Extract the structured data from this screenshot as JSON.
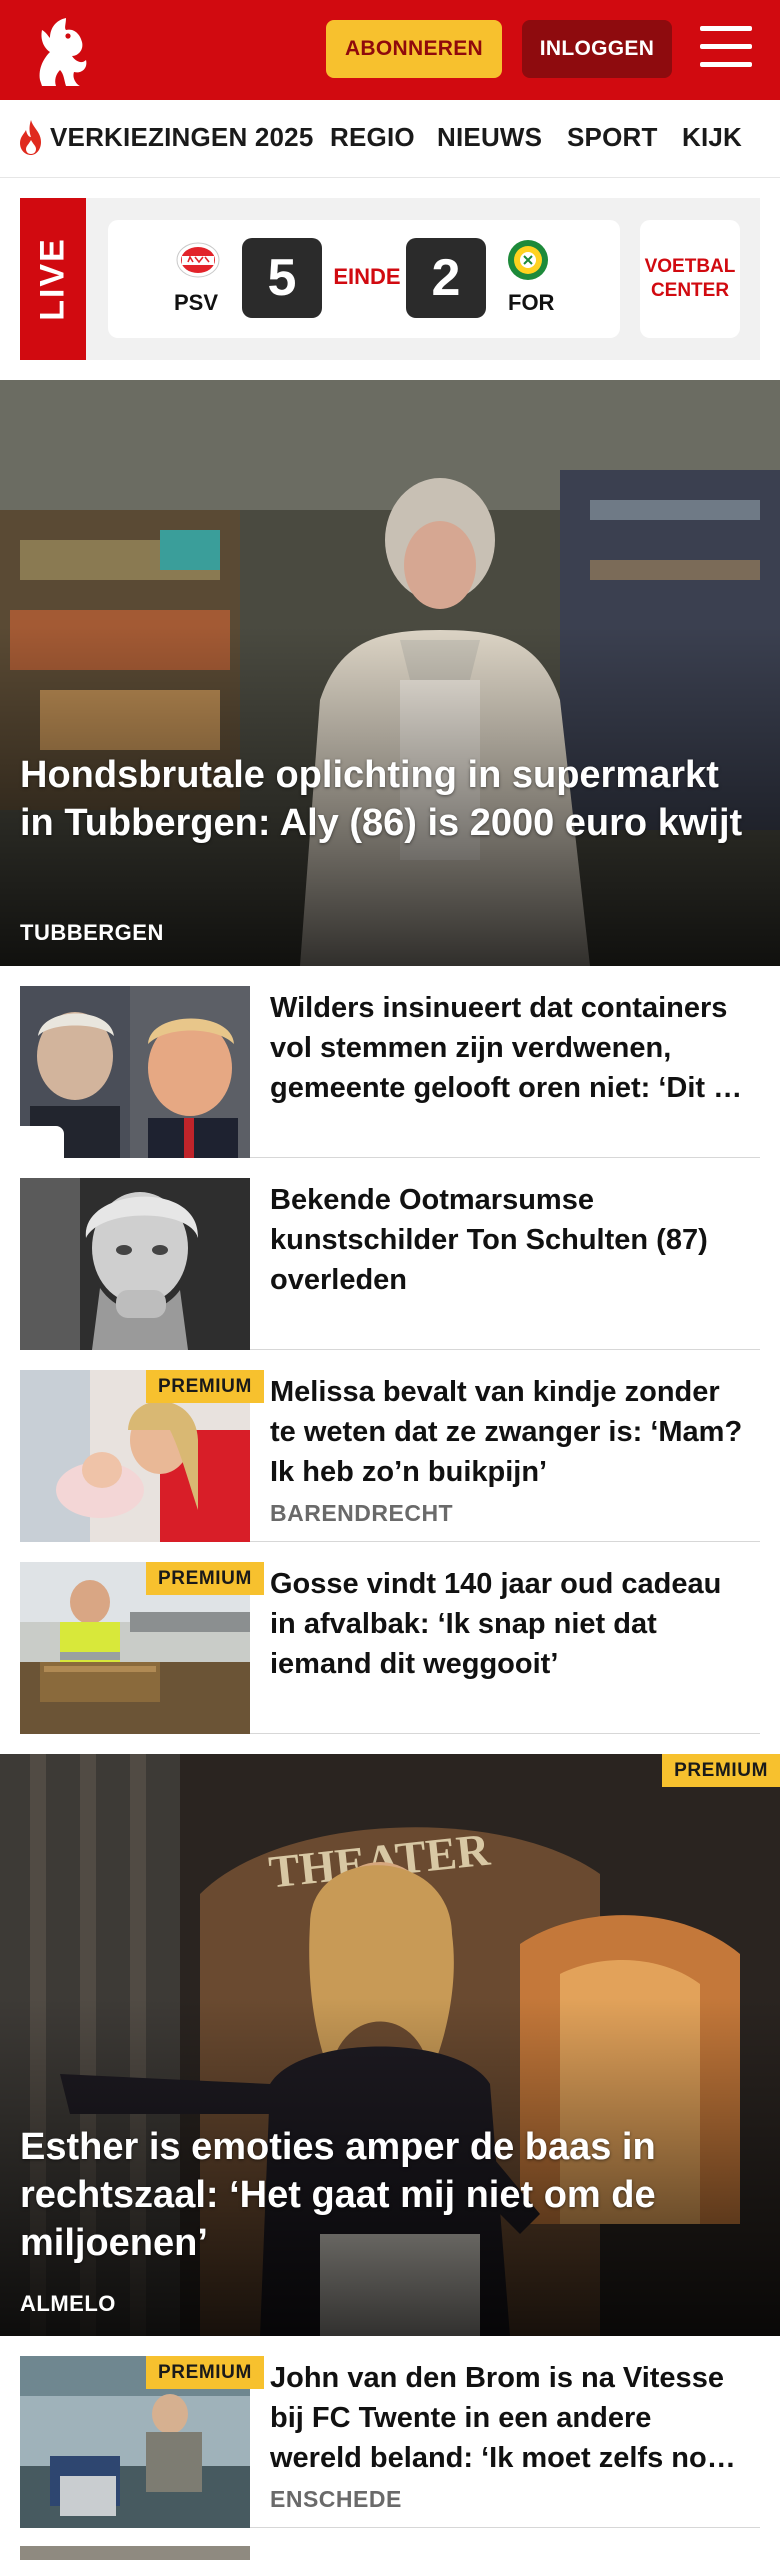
{
  "header": {
    "subscribe_label": "ABONNEREN",
    "login_label": "INLOGGEN",
    "brand_color": "#d10a10",
    "accent_color": "#f7c12e"
  },
  "nav": {
    "items": [
      {
        "label": "VERKIEZINGEN 2025",
        "icon": "flame-icon"
      },
      {
        "label": "REGIO"
      },
      {
        "label": "NIEUWS"
      },
      {
        "label": "SPORT"
      },
      {
        "label": "KIJK"
      }
    ]
  },
  "live_score": {
    "live_label": "LIVE",
    "home_team": "PSV",
    "away_team": "FOR",
    "home_score": "5",
    "away_score": "2",
    "status": "EINDE",
    "voetbal_center_label": "VOETBAL CENTER"
  },
  "hero": {
    "title": "Hondsbrutale oplichting in supermarkt in Tubbergen: Aly (86) is 2000 euro kwijt",
    "location": "TUBBERGEN"
  },
  "articles": [
    {
      "title": "Wilders insinueert dat containers vol stemmen zijn verdwenen, gemeente gelooft oren niet: ‘Dit is echt grote onzin’",
      "location": "",
      "premium": false,
      "comments": true
    },
    {
      "title": "Bekende Ootmarsumse kunstschilder Ton Schulten (87) overleden",
      "location": "",
      "premium": false,
      "comments": false
    },
    {
      "title": "Melissa bevalt van kindje zonder te weten dat ze zwanger is: ‘Mam? Ik heb zo’n buikpijn’",
      "location": "BARENDRECHT",
      "premium": true,
      "premium_label": "PREMIUM"
    },
    {
      "title": "Gosse vindt 140 jaar oud cadeau in afvalbak: ‘Ik snap niet dat iemand dit weggooit’",
      "location": "",
      "premium": true,
      "premium_label": "PREMIUM"
    }
  ],
  "hero2": {
    "title": "Esther is emoties amper de baas in rechtszaal: ‘Het gaat mij niet om de miljoenen’",
    "location": "ALMELO",
    "premium_label": "PREMIUM"
  },
  "articles2": [
    {
      "title": "John van den Brom is na Vitesse bij FC Twente in een andere wereld beland: ‘Ik moet zelfs nog wennen’",
      "location": "ENSCHEDE",
      "premium": true,
      "premium_label": "PREMIUM"
    }
  ]
}
